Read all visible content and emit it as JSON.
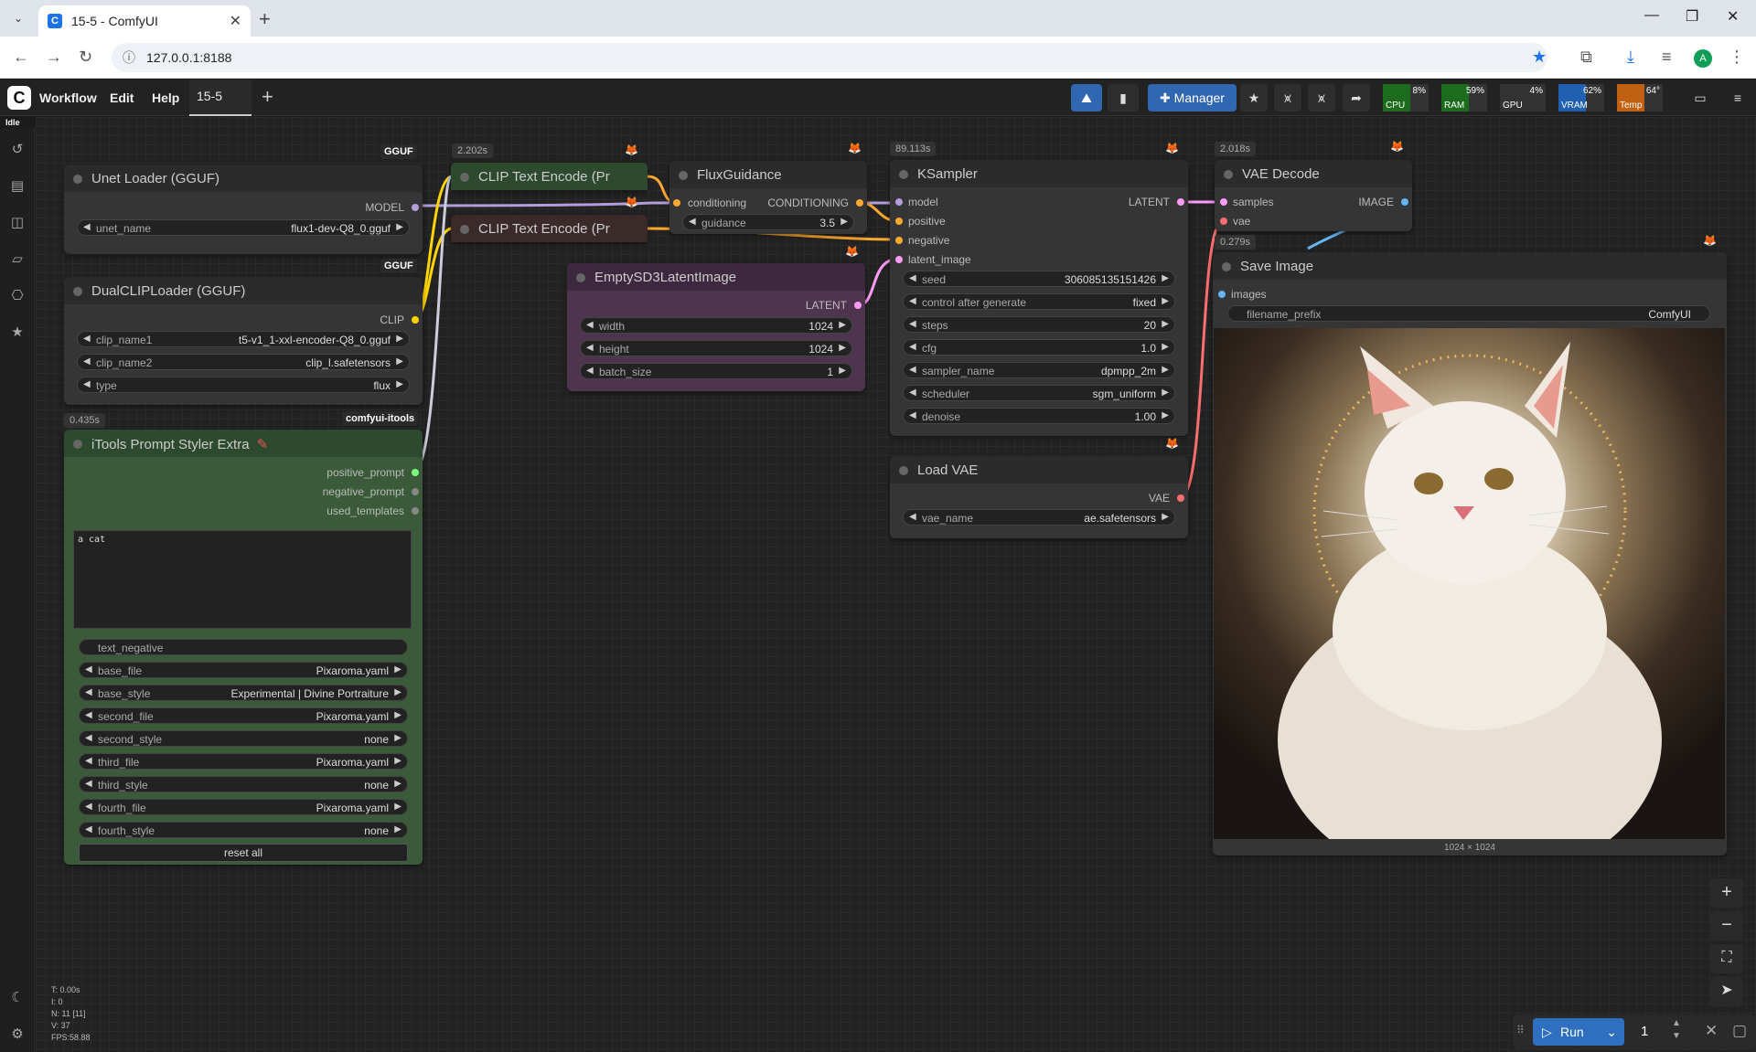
{
  "browser": {
    "tab_title": "15-5 - ComfyUI",
    "url": "127.0.0.1:8188",
    "avatar": "A"
  },
  "menu": {
    "items": [
      "Workflow",
      "Edit",
      "Help"
    ],
    "workflow_tab": "15-5",
    "manager_label": "Manager",
    "status": "Idle"
  },
  "meters": [
    {
      "name": "CPU",
      "pct": "8%",
      "color": "#1d6b1d"
    },
    {
      "name": "RAM",
      "pct": "59%",
      "color": "#1d6b1d"
    },
    {
      "name": "GPU",
      "pct": "4%",
      "color": "#333333"
    },
    {
      "name": "VRAM",
      "pct": "62%",
      "color": "#2060b0"
    },
    {
      "name": "Temp",
      "pct": "64°",
      "color": "#c06010"
    }
  ],
  "nodes": {
    "unet": {
      "tag": "GGUF",
      "title": "Unet Loader (GGUF)",
      "out": "MODEL",
      "w_name": "unet_name",
      "w_val": "flux1-dev-Q8_0.gguf"
    },
    "dualclip": {
      "tag": "GGUF",
      "title": "DualCLIPLoader (GGUF)",
      "out": "CLIP",
      "widgets": [
        {
          "n": "clip_name1",
          "v": "t5-v1_1-xxl-encoder-Q8_0.gguf"
        },
        {
          "n": "clip_name2",
          "v": "clip_l.safetensors"
        },
        {
          "n": "type",
          "v": "flux"
        }
      ]
    },
    "clip1": {
      "time": "2.202s",
      "title": "CLIP Text Encode (Pr"
    },
    "clip2": {
      "title": "CLIP Text Encode (Pr"
    },
    "flux": {
      "title": "FluxGuidance",
      "in": "conditioning",
      "out": "CONDITIONING",
      "w_name": "guidance",
      "w_val": "3.5"
    },
    "empty": {
      "title": "EmptySD3LatentImage",
      "out": "LATENT",
      "widgets": [
        {
          "n": "width",
          "v": "1024"
        },
        {
          "n": "height",
          "v": "1024"
        },
        {
          "n": "batch_size",
          "v": "1"
        }
      ]
    },
    "ksampler": {
      "time": "89.113s",
      "title": "KSampler",
      "out": "LATENT",
      "inputs": [
        "model",
        "positive",
        "negative",
        "latent_image"
      ],
      "widgets": [
        {
          "n": "seed",
          "v": "306085135151426"
        },
        {
          "n": "control after generate",
          "v": "fixed"
        },
        {
          "n": "steps",
          "v": "20"
        },
        {
          "n": "cfg",
          "v": "1.0"
        },
        {
          "n": "sampler_name",
          "v": "dpmpp_2m"
        },
        {
          "n": "scheduler",
          "v": "sgm_uniform"
        },
        {
          "n": "denoise",
          "v": "1.00"
        }
      ]
    },
    "loadvae": {
      "title": "Load VAE",
      "out": "VAE",
      "w_name": "vae_name",
      "w_val": "ae.safetensors"
    },
    "vaedecode": {
      "time": "2.018s",
      "title": "VAE Decode",
      "in1": "samples",
      "in2": "vae",
      "out": "IMAGE"
    },
    "save": {
      "time": "0.279s",
      "title": "Save Image",
      "in": "images",
      "w_name": "filename_prefix",
      "w_val": "ComfyUI",
      "size": "1024 × 1024"
    },
    "itools": {
      "time": "0.435s",
      "tag": "comfyui-itools",
      "title": "iTools Prompt Styler Extra",
      "outputs": [
        "positive_prompt",
        "negative_prompt",
        "used_templates"
      ],
      "prompt": "a cat",
      "text_negative": "text_negative",
      "widgets": [
        {
          "n": "base_file",
          "v": "Pixaroma.yaml"
        },
        {
          "n": "base_style",
          "v": "Experimental | Divine Portraiture"
        },
        {
          "n": "second_file",
          "v": "Pixaroma.yaml"
        },
        {
          "n": "second_style",
          "v": "none"
        },
        {
          "n": "third_file",
          "v": "Pixaroma.yaml"
        },
        {
          "n": "third_style",
          "v": "none"
        },
        {
          "n": "fourth_file",
          "v": "Pixaroma.yaml"
        },
        {
          "n": "fourth_style",
          "v": "none"
        }
      ],
      "reset": "reset all"
    }
  },
  "stats": [
    "T: 0.00s",
    "I: 0",
    "N: 11 [11]",
    "V: 37",
    "FPS:58.88"
  ],
  "run": {
    "label": "Run",
    "count": "1"
  }
}
